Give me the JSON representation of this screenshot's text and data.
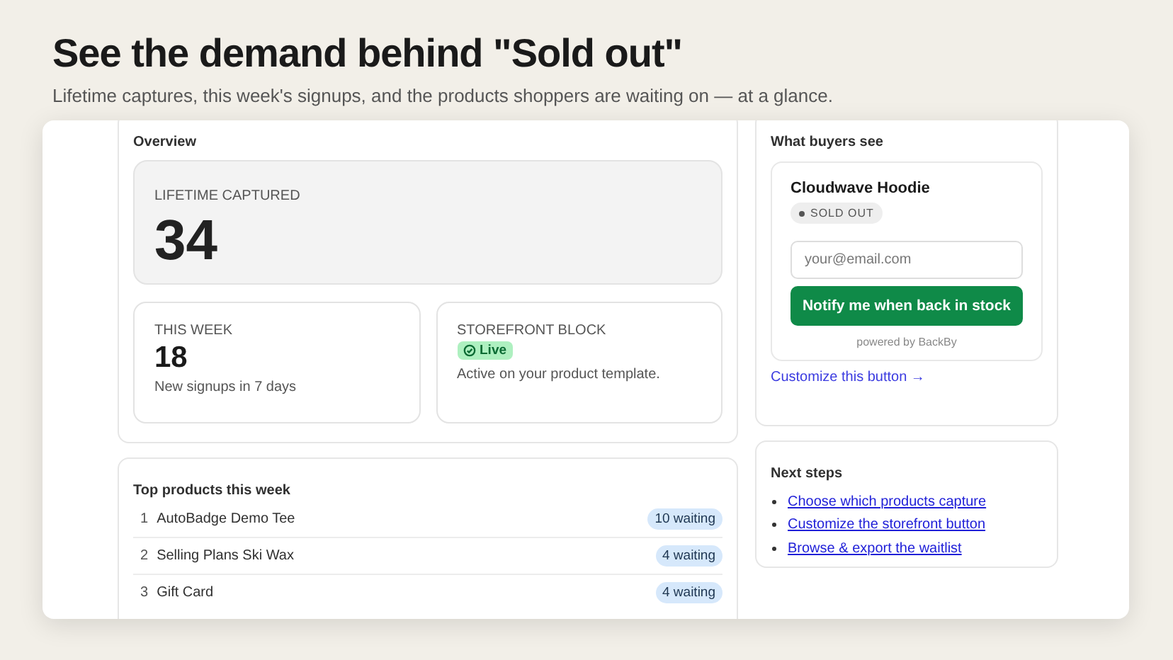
{
  "heading": "See the demand behind \"Sold out\"",
  "subheading": "Lifetime captures, this week's signups, and the products shoppers are waiting on — at a glance.",
  "overview": {
    "title": "Overview",
    "lifetime": {
      "label": "LIFETIME CAPTURED",
      "value": "34"
    },
    "this_week": {
      "label": "THIS WEEK",
      "value": "18",
      "note": "New signups in 7 days"
    },
    "storefront": {
      "label": "STOREFRONT BLOCK",
      "status": "Live",
      "live": true,
      "note": "Active on your product template."
    }
  },
  "preview": {
    "title": "What buyers see",
    "product": "Cloudwave Hoodie",
    "badge": "SOLD OUT",
    "email": {
      "placeholder": "your@email.com"
    },
    "button": "Notify me when back in stock",
    "powered": "powered by BackBy",
    "link": "Customize this button →"
  },
  "top_products": {
    "title": "Top products this week",
    "rows": [
      {
        "rank": "1",
        "name": "AutoBadge Demo Tee",
        "waiting": "10 waiting"
      },
      {
        "rank": "2",
        "name": "Selling Plans Ski Wax",
        "waiting": "4 waiting"
      },
      {
        "rank": "3",
        "name": "Gift Card",
        "waiting": "4 waiting"
      }
    ]
  },
  "next_steps": {
    "title": "Next steps",
    "links": [
      "Choose which products capture",
      "Customize the storefront button",
      "Browse & export the waitlist"
    ]
  }
}
